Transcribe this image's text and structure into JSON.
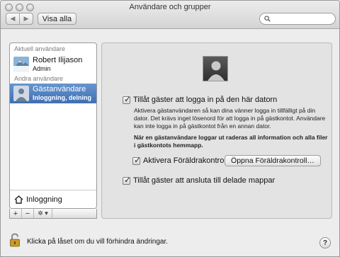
{
  "window": {
    "title": "Användare och grupper"
  },
  "toolbar": {
    "back": "◀",
    "forward": "▶",
    "show_all": "Visa alla",
    "search_placeholder": ""
  },
  "sidebar": {
    "current_header": "Aktuell användare",
    "current_user": {
      "name": "Robert Ilijason",
      "role": "Admin"
    },
    "other_header": "Andra användare",
    "other_users": [
      {
        "name": "Gästanvändare",
        "sub": "Inloggning, delning"
      }
    ],
    "login_options": "Inloggning",
    "controls": {
      "add": "+",
      "remove": "−",
      "gear": "✲ ▾"
    }
  },
  "guest": {
    "allow_login": {
      "label": "Tillåt gäster att logga in på den här datorn",
      "checked": true,
      "desc": "Aktivera gästanvändaren så kan dina vänner logga in tillfälligt på din dator. Det krävs inget lösenord för att logga in på gästkontot. Användare kan inte logga in på gästkontot från en annan dator.",
      "note": "När en gästanvändare loggar ut raderas all information och alla filer i gästkontots hemmapp."
    },
    "parental": {
      "label": "Aktivera Föräldrakontroll",
      "checked": true,
      "button": "Öppna Föräldrakontroll…"
    },
    "shared": {
      "label": "Tillåt gäster att ansluta till delade mappar",
      "checked": true
    }
  },
  "footer": {
    "lock_text": "Klicka på låset om du vill förhindra ändringar.",
    "help": "?"
  }
}
